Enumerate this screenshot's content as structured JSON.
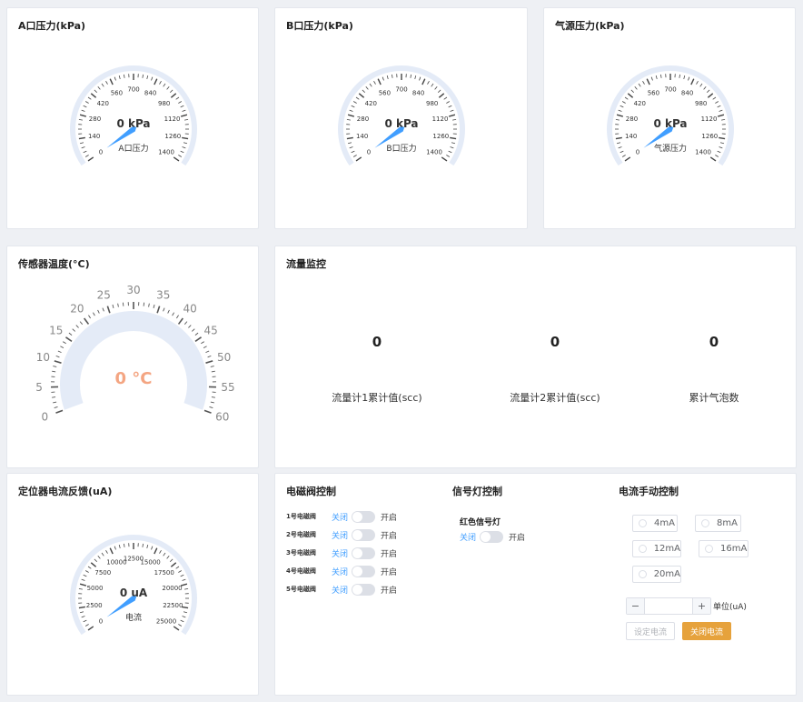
{
  "pressure_a": {
    "title": "A口压力(kPa)",
    "value_text": "0 kPa",
    "label": "A口压力",
    "value": 0,
    "min": 0,
    "max": 1400,
    "ticks": [
      "0",
      "140",
      "280",
      "420",
      "560",
      "700",
      "840",
      "980",
      "1120",
      "1260",
      "1400"
    ]
  },
  "pressure_b": {
    "title": "B口压力(kPa)",
    "value_text": "0 kPa",
    "label": "B口压力",
    "value": 0,
    "min": 0,
    "max": 1400,
    "ticks": [
      "0",
      "140",
      "280",
      "420",
      "560",
      "700",
      "840",
      "980",
      "1120",
      "1260",
      "1400"
    ]
  },
  "pressure_src": {
    "title": "气源压力(kPa)",
    "value_text": "0 kPa",
    "label": "气源压力",
    "value": 0,
    "min": 0,
    "max": 1400,
    "ticks": [
      "0",
      "140",
      "280",
      "420",
      "560",
      "700",
      "840",
      "980",
      "1120",
      "1260",
      "1400"
    ]
  },
  "temperature": {
    "title": "传感器温度(°C)",
    "value_text": "0 °C",
    "value": 0,
    "min": 0,
    "max": 60,
    "ticks": [
      "0",
      "5",
      "10",
      "15",
      "20",
      "25",
      "30",
      "35",
      "40",
      "45",
      "50",
      "55",
      "60"
    ]
  },
  "flow": {
    "title": "流量监控",
    "items": [
      {
        "value": "0",
        "label": "流量计1累计值(scc)"
      },
      {
        "value": "0",
        "label": "流量计2累计值(scc)"
      },
      {
        "value": "0",
        "label": "累计气泡数"
      }
    ]
  },
  "current": {
    "title": "定位器电流反馈(uA)",
    "value_text": "0 uA",
    "label": "电流",
    "value": 0,
    "min": 0,
    "max": 25000,
    "ticks": [
      "0",
      "2500",
      "5000",
      "7500",
      "10000",
      "12500",
      "15000",
      "17500",
      "20000",
      "22500",
      "25000"
    ]
  },
  "solenoid": {
    "title": "电磁阀控制",
    "off": "关闭",
    "on": "开启",
    "items": [
      {
        "name": "1号电磁阀",
        "state": false
      },
      {
        "name": "2号电磁阀",
        "state": false
      },
      {
        "name": "3号电磁阀",
        "state": false
      },
      {
        "name": "4号电磁阀",
        "state": false
      },
      {
        "name": "5号电磁阀",
        "state": false
      }
    ]
  },
  "signal": {
    "title": "信号灯控制",
    "light_name": "红色信号灯",
    "off": "关闭",
    "on": "开启",
    "state": false
  },
  "manual_current": {
    "title": "电流手动控制",
    "options": [
      "4mA",
      "8mA",
      "12mA",
      "16mA",
      "20mA"
    ],
    "input_value": "",
    "unit": "单位(uA)",
    "set_button": "设定电流",
    "close_button": "关闭电流"
  },
  "colors": {
    "needle": "#409eff",
    "arc": "#e4ebf7",
    "temp_value": "#f4a582",
    "accent_button": "#e6a23c"
  }
}
